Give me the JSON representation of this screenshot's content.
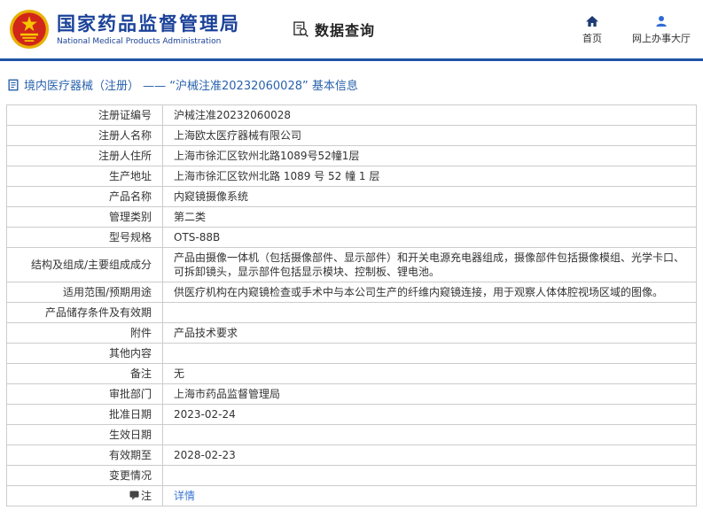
{
  "header": {
    "org_name_cn": "国家药品监督管理局",
    "org_name_en": "National Medical Products Administration",
    "data_query": "数据查询",
    "nav": [
      {
        "label": "首页",
        "icon": "home-icon"
      },
      {
        "label": "网上办事大厅",
        "icon": "user-icon"
      }
    ]
  },
  "breadcrumb": "境内医疗器械（注册） ——  “沪械注准20232060028” 基本信息",
  "colors": {
    "primary_blue": "#1f53a6",
    "title_blue": "#1b4299",
    "link_blue": "#3a76d2",
    "emblem_red": "#d1261a",
    "emblem_gold": "#f7c600",
    "border_gray": "#cccccc"
  },
  "table": {
    "rows": [
      {
        "label": "注册证编号",
        "value": "沪械注准20232060028"
      },
      {
        "label": "注册人名称",
        "value": "上海欧太医疗器械有限公司"
      },
      {
        "label": "注册人住所",
        "value": "上海市徐汇区钦州北路1089号52幢1层"
      },
      {
        "label": "生产地址",
        "value": "上海市徐汇区钦州北路 1089 号 52 幢 1 层"
      },
      {
        "label": "产品名称",
        "value": "内窥镜摄像系统"
      },
      {
        "label": "管理类别",
        "value": "第二类"
      },
      {
        "label": "型号规格",
        "value": "OTS-88B"
      },
      {
        "label": "结构及组成/主要组成成分",
        "value": "产品由摄像一体机（包括摄像部件、显示部件）和开关电源充电器组成，摄像部件包括摄像模组、光学卡口、可拆卸镜头，显示部件包括显示模块、控制板、锂电池。"
      },
      {
        "label": "适用范围/预期用途",
        "value": "供医疗机构在内窥镜检查或手术中与本公司生产的纤维内窥镜连接，用于观察人体体腔视场区域的图像。"
      },
      {
        "label": "产品储存条件及有效期",
        "value": ""
      },
      {
        "label": "附件",
        "value": "产品技术要求"
      },
      {
        "label": "其他内容",
        "value": ""
      },
      {
        "label": "备注",
        "value": "无"
      },
      {
        "label": "审批部门",
        "value": "上海市药品监督管理局"
      },
      {
        "label": "批准日期",
        "value": "2023-02-24"
      },
      {
        "label": "生效日期",
        "value": ""
      },
      {
        "label": "有效期至",
        "value": "2028-02-23"
      },
      {
        "label": "变更情况",
        "value": ""
      },
      {
        "label": "注",
        "value": "详情"
      }
    ]
  }
}
